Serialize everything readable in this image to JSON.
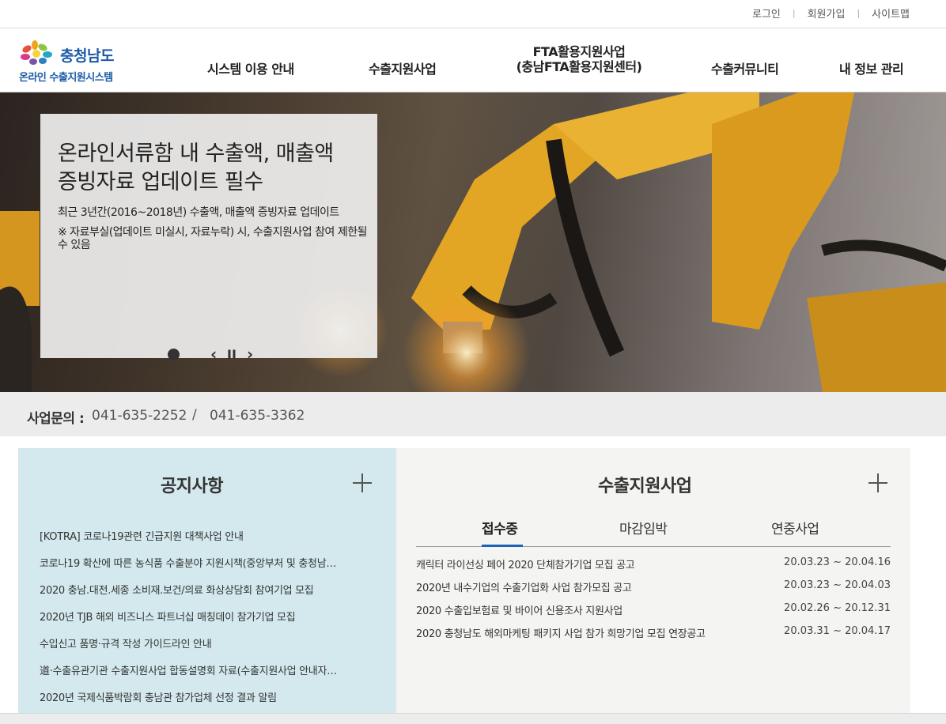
{
  "util_links": [
    "로그인",
    "회원가입",
    "사이트맵"
  ],
  "logo": {
    "title": "충청남도",
    "subtitle": "온라인 수출지원시스템"
  },
  "nav": [
    {
      "label": "시스템 이용 안내"
    },
    {
      "label": "수출지원사업"
    },
    {
      "line1": "FTA활용지원사업",
      "line2": "(충남FTA활용지원센터)"
    },
    {
      "label": "수출커뮤니티"
    },
    {
      "label": "내 정보 관리"
    }
  ],
  "hero": {
    "title_line1": "온라인서류함 내 수출액, 매출액",
    "title_line2": "증빙자료 업데이트 필수",
    "desc1": "최근 3년간(2016~2018년) 수출액, 매출액 증빙자료 업데이트",
    "desc2": "※ 자료부실(업데이트 미실시, 자료누락) 시, 수출지원사업 참여 제한될 수 있음",
    "prev": "‹",
    "pause": "II",
    "next": "›"
  },
  "contact": {
    "label": "사업문의 :",
    "phone1": "041-635-2252",
    "separator": "/",
    "phone2": "041-635-3362"
  },
  "notice": {
    "title": "공지사항",
    "items": [
      "[KOTRA] 코로나19관련 긴급지원 대책사업 안내",
      "코로나19 확산에 따른 농식품 수출분야 지원시책(중앙부처 및 충청남…",
      "2020 충남.대전.세종 소비재.보건/의료 화상상담회 참여기업 모집",
      "2020년 TJB 해외 비즈니스 파트너십 매칭데이 참가기업 모집",
      "수입신고 품명·규격 작성 가이드라인 안내",
      "道·수출유관기관 수출지원사업 합동설명회 자료(수출지원사업 안내자…",
      "2020년 국제식품박람회 충남관 참가업체 선정 결과 알림"
    ]
  },
  "support": {
    "title": "수출지원사업",
    "tabs": [
      "접수중",
      "마감임박",
      "연중사업"
    ],
    "items": [
      {
        "title": "캐릭터 라이선싱 페어 2020 단체참가기업 모집 공고",
        "date": "20.03.23 ~ 20.04.16"
      },
      {
        "title": "2020년 내수기업의 수출기업화 사업 참가모집 공고",
        "date": "20.03.23 ~ 20.04.03"
      },
      {
        "title": "2020 수출입보험료 및 바이어 신용조사 지원사업",
        "date": "20.02.26 ~ 20.12.31"
      },
      {
        "title": "2020 충청남도 해외마케팅 패키지 사업 참가 희망기업 모집 연장공고",
        "date": "20.03.31 ~ 20.04.17"
      }
    ]
  }
}
